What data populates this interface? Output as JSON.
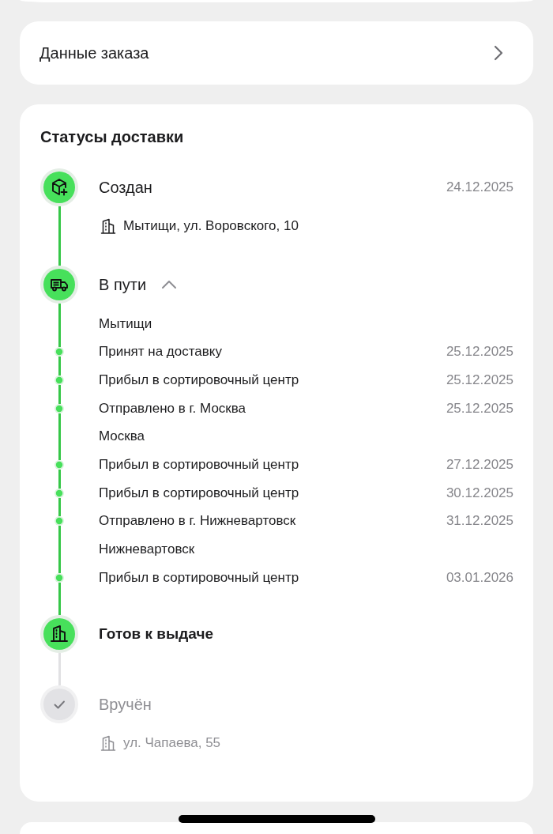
{
  "order_details": {
    "label": "Данные заказа"
  },
  "delivery_statuses": {
    "title": "Статусы доставки",
    "steps": [
      {
        "kind": "created",
        "title": "Создан",
        "date": "24.12.2025",
        "address": "Мытищи, ул. Воровского, 10",
        "done": true,
        "current": false
      },
      {
        "kind": "in_transit",
        "title": "В пути",
        "done": true,
        "current": false,
        "expanded": true,
        "legs": [
          {
            "city": "Мытищи",
            "events": [
              {
                "label": "Принят на доставку",
                "date": "25.12.2025"
              },
              {
                "label": "Прибыл в сортировочный центр",
                "date": "25.12.2025"
              },
              {
                "label": "Отправлено в г. Москва",
                "date": "25.12.2025"
              }
            ]
          },
          {
            "city": "Москва",
            "events": [
              {
                "label": "Прибыл в сортировочный центр",
                "date": "27.12.2025"
              },
              {
                "label": "Прибыл в сортировочный центр",
                "date": "30.12.2025"
              },
              {
                "label": "Отправлено в г. Нижневартовск",
                "date": "31.12.2025"
              }
            ]
          },
          {
            "city": "Нижневартовск",
            "events": [
              {
                "label": "Прибыл в сортировочный центр",
                "date": "03.01.2026"
              }
            ]
          }
        ]
      },
      {
        "kind": "ready",
        "title": "Готов к выдаче",
        "done": true,
        "current": true
      },
      {
        "kind": "delivered",
        "title": "Вручён",
        "address": "ул. Чапаева, 55",
        "done": false,
        "current": false
      }
    ]
  }
}
